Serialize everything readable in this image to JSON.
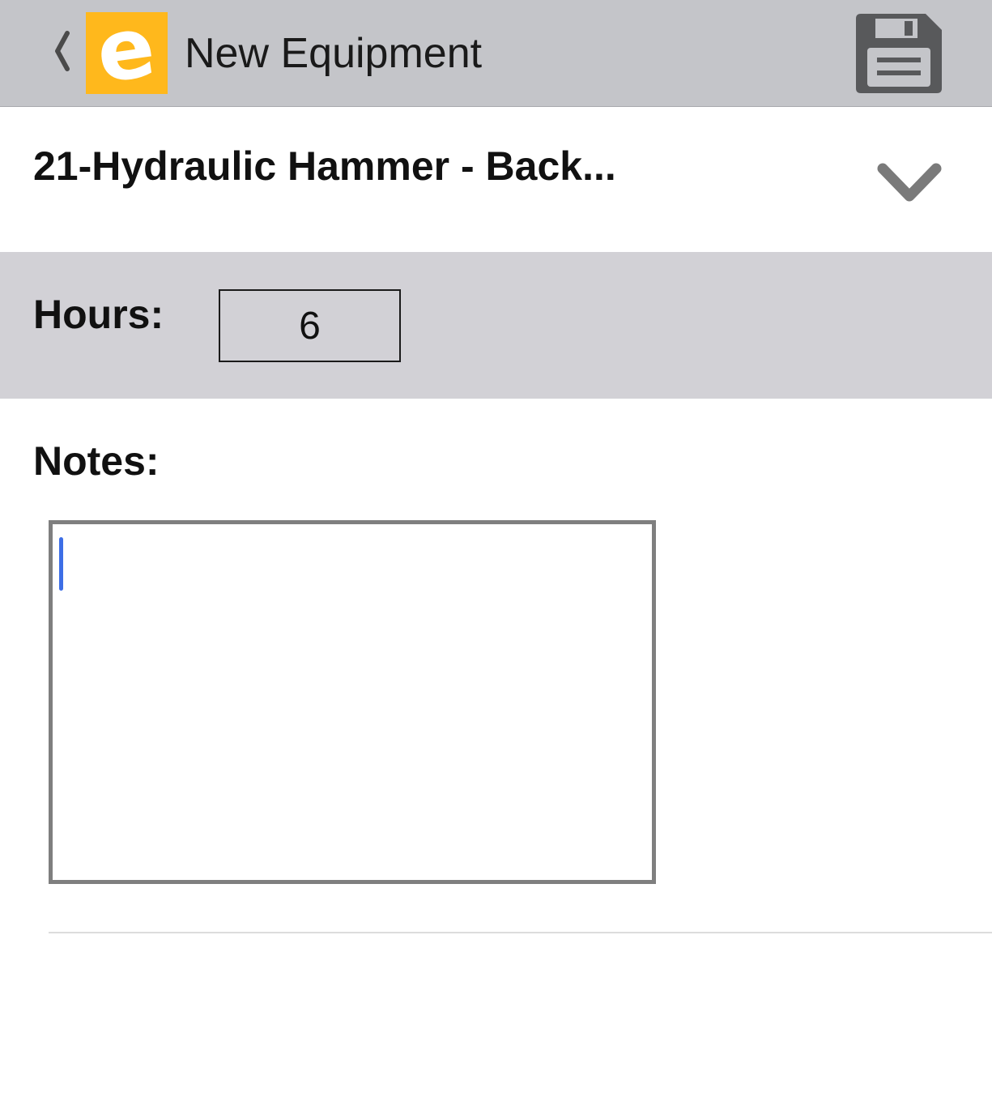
{
  "nav": {
    "back_icon": "chevron-left-icon",
    "logo_icon": "e-logo-icon",
    "logo_text": "e",
    "title": "New Equipment",
    "save_icon": "floppy-disk-icon"
  },
  "equipment": {
    "selected": "21-Hydraulic Hammer - Back...",
    "dropdown_icon": "chevron-down-icon"
  },
  "hours": {
    "label": "Hours:",
    "value": "6"
  },
  "notes": {
    "label": "Notes:",
    "value": ""
  },
  "colors": {
    "nav_background": "#c4c5c9",
    "hours_background": "#d2d1d6",
    "logo_background": "#ffb81c",
    "save_icon": "#58595b",
    "chevron": "#7a7a7a",
    "cursor": "#3d6ee6"
  }
}
